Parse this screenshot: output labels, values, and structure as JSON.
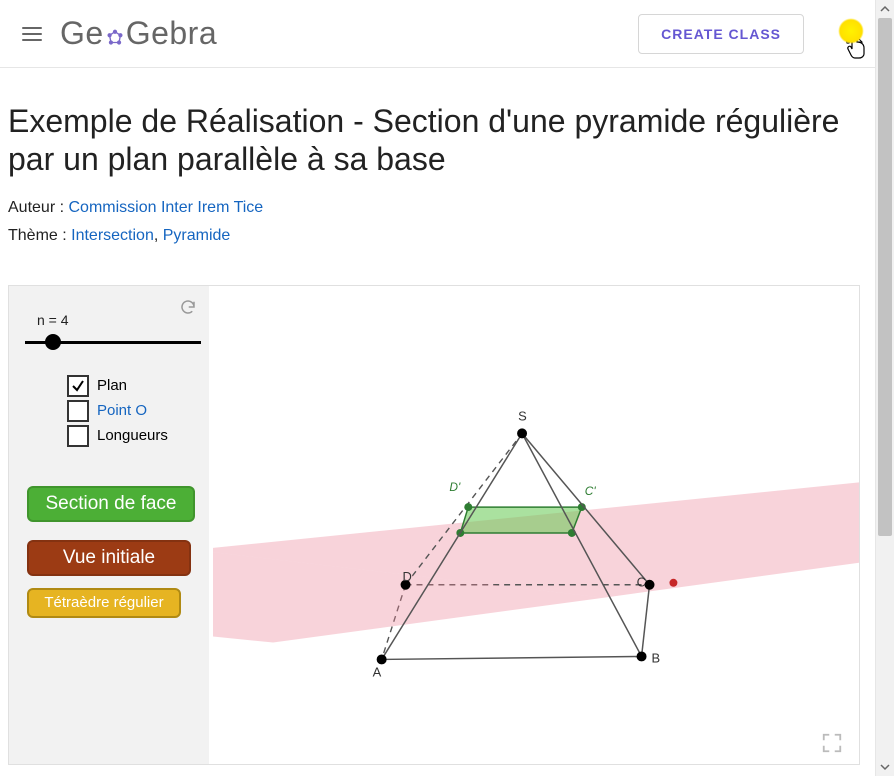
{
  "header": {
    "logo_pre": "Ge",
    "logo_post": "Gebra",
    "create_class": "CREATE CLASS"
  },
  "title": "Exemple de Réalisation - Section d'une pyramide régulière par un plan parallèle à sa base",
  "author_label": "Auteur :",
  "author": "Commission Inter Irem Tice",
  "theme_label": "Thème :",
  "themes": [
    "Intersection",
    "Pyramide"
  ],
  "applet": {
    "slider": {
      "label": "n = 4",
      "value": 4,
      "pos_pct": 14
    },
    "checks": [
      {
        "key": "plan",
        "label": "Plan",
        "checked": true,
        "blue": false
      },
      {
        "key": "pointO",
        "label": "Point O",
        "checked": false,
        "blue": true
      },
      {
        "key": "longueurs",
        "label": "Longueurs",
        "checked": false,
        "blue": false
      }
    ],
    "buttons": {
      "section": "Section de face",
      "vue": "Vue initiale",
      "tetra": "Tétraèdre régulier"
    },
    "vertices": {
      "S": "S",
      "A": "A",
      "B": "B",
      "C": "C",
      "D": "D",
      "Dp": "D'",
      "Cp": "C'"
    }
  }
}
